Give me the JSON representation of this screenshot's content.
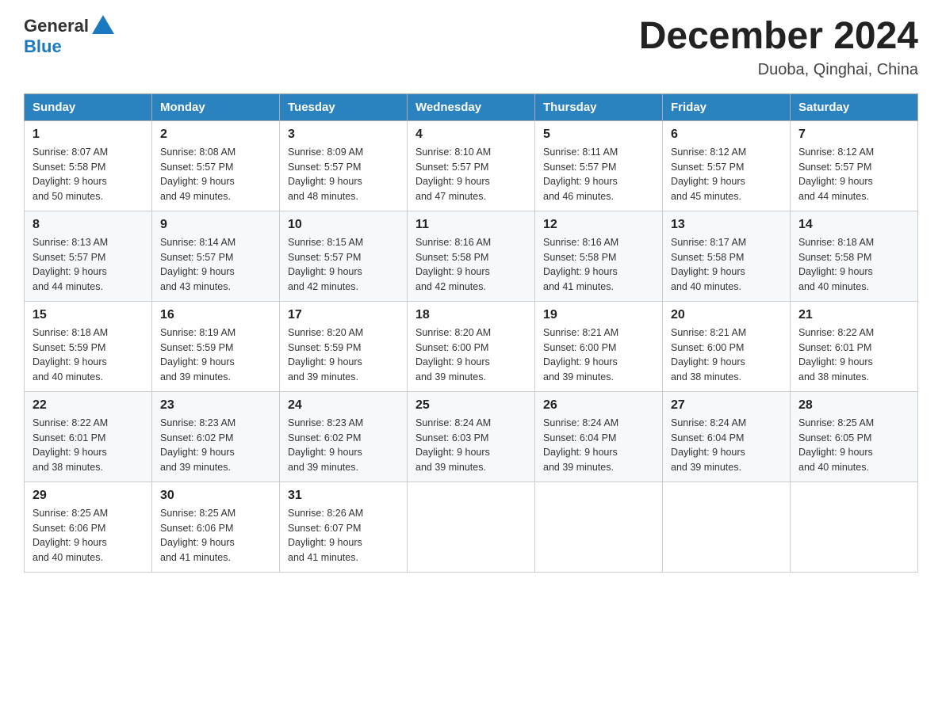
{
  "header": {
    "logo_general": "General",
    "logo_blue": "Blue",
    "month_title": "December 2024",
    "location": "Duoba, Qinghai, China"
  },
  "weekdays": [
    "Sunday",
    "Monday",
    "Tuesday",
    "Wednesday",
    "Thursday",
    "Friday",
    "Saturday"
  ],
  "weeks": [
    [
      {
        "day": "1",
        "sunrise": "8:07 AM",
        "sunset": "5:58 PM",
        "daylight": "9 hours and 50 minutes."
      },
      {
        "day": "2",
        "sunrise": "8:08 AM",
        "sunset": "5:57 PM",
        "daylight": "9 hours and 49 minutes."
      },
      {
        "day": "3",
        "sunrise": "8:09 AM",
        "sunset": "5:57 PM",
        "daylight": "9 hours and 48 minutes."
      },
      {
        "day": "4",
        "sunrise": "8:10 AM",
        "sunset": "5:57 PM",
        "daylight": "9 hours and 47 minutes."
      },
      {
        "day": "5",
        "sunrise": "8:11 AM",
        "sunset": "5:57 PM",
        "daylight": "9 hours and 46 minutes."
      },
      {
        "day": "6",
        "sunrise": "8:12 AM",
        "sunset": "5:57 PM",
        "daylight": "9 hours and 45 minutes."
      },
      {
        "day": "7",
        "sunrise": "8:12 AM",
        "sunset": "5:57 PM",
        "daylight": "9 hours and 44 minutes."
      }
    ],
    [
      {
        "day": "8",
        "sunrise": "8:13 AM",
        "sunset": "5:57 PM",
        "daylight": "9 hours and 44 minutes."
      },
      {
        "day": "9",
        "sunrise": "8:14 AM",
        "sunset": "5:57 PM",
        "daylight": "9 hours and 43 minutes."
      },
      {
        "day": "10",
        "sunrise": "8:15 AM",
        "sunset": "5:57 PM",
        "daylight": "9 hours and 42 minutes."
      },
      {
        "day": "11",
        "sunrise": "8:16 AM",
        "sunset": "5:58 PM",
        "daylight": "9 hours and 42 minutes."
      },
      {
        "day": "12",
        "sunrise": "8:16 AM",
        "sunset": "5:58 PM",
        "daylight": "9 hours and 41 minutes."
      },
      {
        "day": "13",
        "sunrise": "8:17 AM",
        "sunset": "5:58 PM",
        "daylight": "9 hours and 40 minutes."
      },
      {
        "day": "14",
        "sunrise": "8:18 AM",
        "sunset": "5:58 PM",
        "daylight": "9 hours and 40 minutes."
      }
    ],
    [
      {
        "day": "15",
        "sunrise": "8:18 AM",
        "sunset": "5:59 PM",
        "daylight": "9 hours and 40 minutes."
      },
      {
        "day": "16",
        "sunrise": "8:19 AM",
        "sunset": "5:59 PM",
        "daylight": "9 hours and 39 minutes."
      },
      {
        "day": "17",
        "sunrise": "8:20 AM",
        "sunset": "5:59 PM",
        "daylight": "9 hours and 39 minutes."
      },
      {
        "day": "18",
        "sunrise": "8:20 AM",
        "sunset": "6:00 PM",
        "daylight": "9 hours and 39 minutes."
      },
      {
        "day": "19",
        "sunrise": "8:21 AM",
        "sunset": "6:00 PM",
        "daylight": "9 hours and 39 minutes."
      },
      {
        "day": "20",
        "sunrise": "8:21 AM",
        "sunset": "6:00 PM",
        "daylight": "9 hours and 38 minutes."
      },
      {
        "day": "21",
        "sunrise": "8:22 AM",
        "sunset": "6:01 PM",
        "daylight": "9 hours and 38 minutes."
      }
    ],
    [
      {
        "day": "22",
        "sunrise": "8:22 AM",
        "sunset": "6:01 PM",
        "daylight": "9 hours and 38 minutes."
      },
      {
        "day": "23",
        "sunrise": "8:23 AM",
        "sunset": "6:02 PM",
        "daylight": "9 hours and 39 minutes."
      },
      {
        "day": "24",
        "sunrise": "8:23 AM",
        "sunset": "6:02 PM",
        "daylight": "9 hours and 39 minutes."
      },
      {
        "day": "25",
        "sunrise": "8:24 AM",
        "sunset": "6:03 PM",
        "daylight": "9 hours and 39 minutes."
      },
      {
        "day": "26",
        "sunrise": "8:24 AM",
        "sunset": "6:04 PM",
        "daylight": "9 hours and 39 minutes."
      },
      {
        "day": "27",
        "sunrise": "8:24 AM",
        "sunset": "6:04 PM",
        "daylight": "9 hours and 39 minutes."
      },
      {
        "day": "28",
        "sunrise": "8:25 AM",
        "sunset": "6:05 PM",
        "daylight": "9 hours and 40 minutes."
      }
    ],
    [
      {
        "day": "29",
        "sunrise": "8:25 AM",
        "sunset": "6:06 PM",
        "daylight": "9 hours and 40 minutes."
      },
      {
        "day": "30",
        "sunrise": "8:25 AM",
        "sunset": "6:06 PM",
        "daylight": "9 hours and 41 minutes."
      },
      {
        "day": "31",
        "sunrise": "8:26 AM",
        "sunset": "6:07 PM",
        "daylight": "9 hours and 41 minutes."
      },
      null,
      null,
      null,
      null
    ]
  ],
  "labels": {
    "sunrise": "Sunrise:",
    "sunset": "Sunset:",
    "daylight": "Daylight:"
  }
}
